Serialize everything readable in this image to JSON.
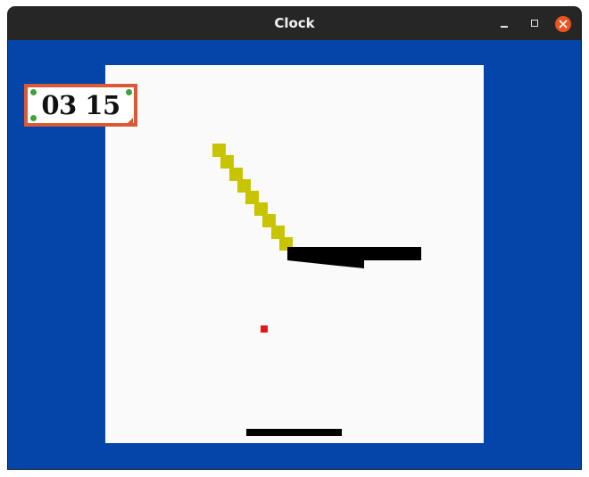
{
  "window": {
    "title": "Clock"
  },
  "titlebar_buttons": {
    "minimize": "minimize",
    "maximize": "maximize",
    "close": "close"
  },
  "clock": {
    "display": "03 15"
  },
  "colors": {
    "background": "#0345a9",
    "canvas": "#fafafa",
    "clock_border": "#d85a36",
    "clock_dots": "#3fa23a",
    "trail": "#c9c400",
    "target": "#e8141c",
    "bars": "#000000"
  }
}
